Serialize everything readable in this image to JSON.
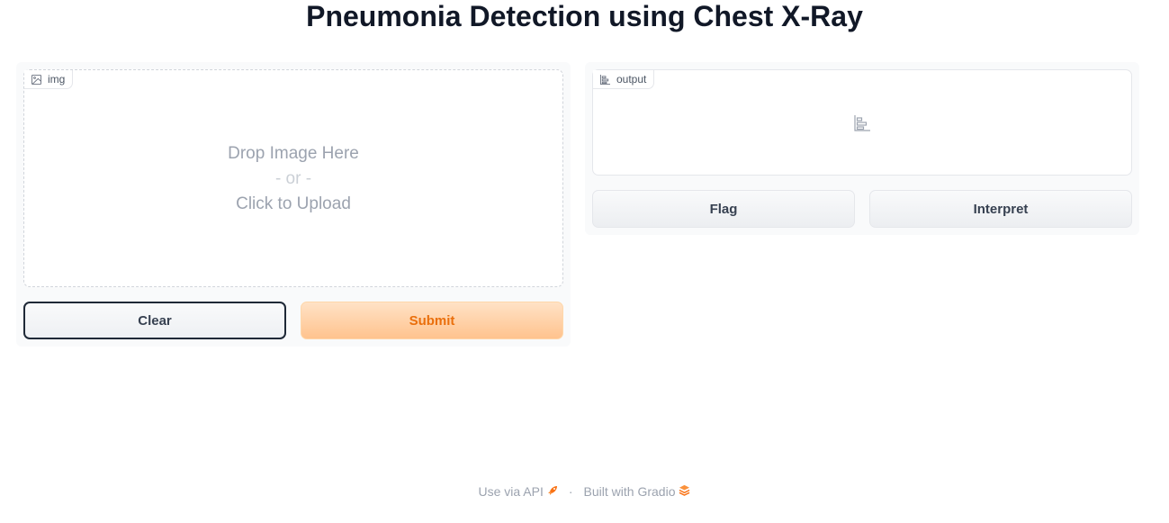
{
  "header": {
    "title": "Pneumonia Detection using Chest X-Ray"
  },
  "input": {
    "label": "img",
    "upload_line1": "Drop Image Here",
    "upload_line2": "- or -",
    "upload_line3": "Click to Upload",
    "icon": "image-icon"
  },
  "input_actions": {
    "clear_label": "Clear",
    "submit_label": "Submit"
  },
  "output": {
    "label": "output",
    "icon": "bar-chart-icon"
  },
  "output_actions": {
    "flag_label": "Flag",
    "interpret_label": "Interpret"
  },
  "footer": {
    "api_label": "Use via API",
    "separator": "·",
    "built_label": "Built with Gradio"
  },
  "colors": {
    "accent": "#f97316",
    "submit_bg": "#ffc38e",
    "text": "#111827"
  }
}
